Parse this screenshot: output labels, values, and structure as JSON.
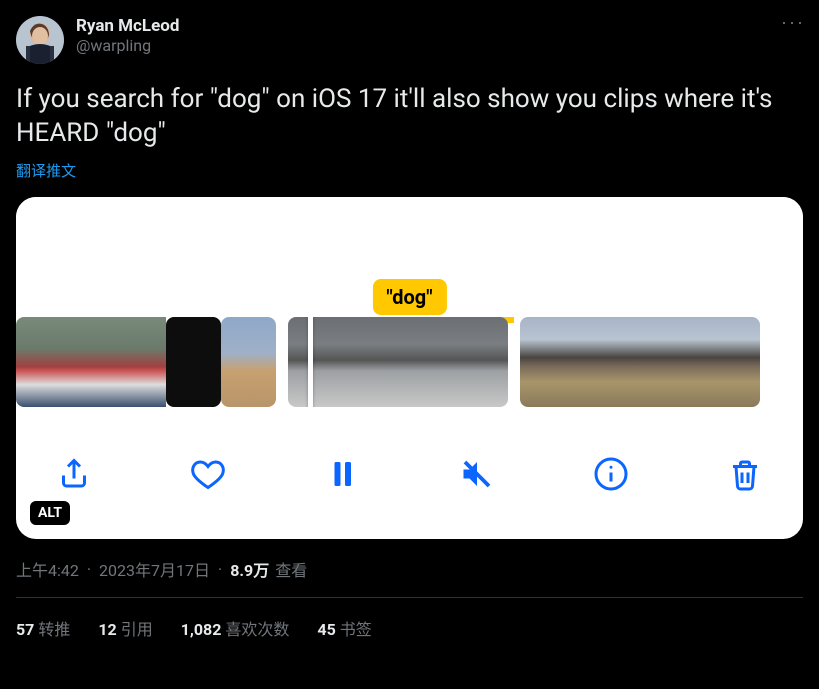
{
  "author": {
    "display_name": "Ryan McLeod",
    "handle": "@warpling"
  },
  "tweet_text": "If you search for \"dog\" on iOS 17 it'll also show you clips where it's HEARD \"dog\"",
  "translate_label": "翻译推文",
  "media": {
    "caption_label": "\"dog\"",
    "alt_badge": "ALT",
    "icons": {
      "share": "share-icon",
      "like": "heart-icon",
      "pause": "pause-icon",
      "mute": "mute-icon",
      "info": "info-icon",
      "trash": "trash-icon"
    }
  },
  "meta": {
    "time": "上午4:42",
    "date": "2023年7月17日",
    "views_count": "8.9万",
    "views_label": "查看"
  },
  "stats": {
    "retweets_count": "57",
    "retweets_label": "转推",
    "quotes_count": "12",
    "quotes_label": "引用",
    "likes_count": "1,082",
    "likes_label": "喜欢次数",
    "bookmarks_count": "45",
    "bookmarks_label": "书签"
  },
  "more_label": "···"
}
